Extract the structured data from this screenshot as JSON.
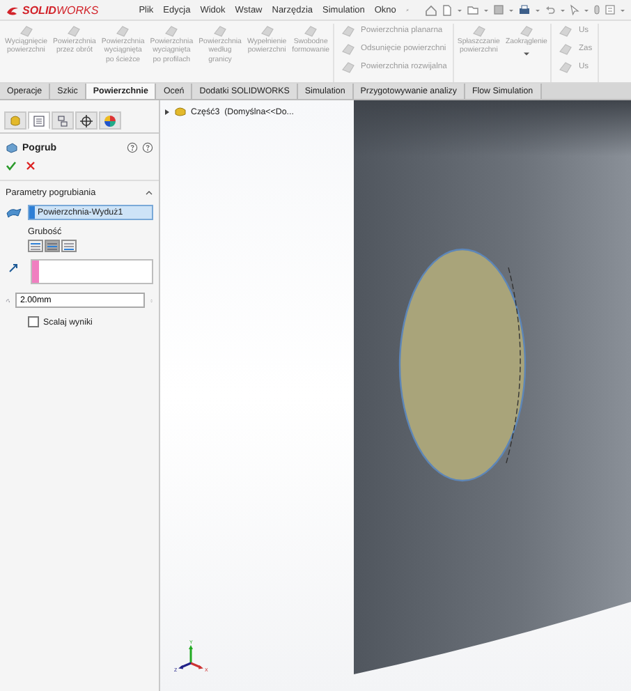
{
  "app": {
    "logo": "**SOLID**WORKS"
  },
  "menu": [
    "Plik",
    "Edycja",
    "Widok",
    "Wstaw",
    "Narzędzia",
    "Simulation",
    "Okno"
  ],
  "ribbon": [
    {
      "kind": "big",
      "lines": [
        "Wyciągnięcie",
        "powierzchni"
      ],
      "disabled": true
    },
    {
      "kind": "big",
      "lines": [
        "Powierzchnia",
        "przez obrót"
      ],
      "disabled": true
    },
    {
      "kind": "big",
      "lines": [
        "Powierzchnia",
        "wyciągnięta",
        "po ścieżce"
      ],
      "disabled": true
    },
    {
      "kind": "big",
      "lines": [
        "Powierzchnia",
        "wyciągnięta",
        "po profilach"
      ],
      "disabled": true
    },
    {
      "kind": "big",
      "lines": [
        "Powierzchnia",
        "według",
        "granicy"
      ],
      "disabled": true
    },
    {
      "kind": "big",
      "lines": [
        "Wypełnienie",
        "powierzchni"
      ],
      "disabled": true
    },
    {
      "kind": "big",
      "lines": [
        "Swobodne",
        "formowanie"
      ],
      "disabled": true
    },
    {
      "kind": "stack",
      "items": [
        {
          "label": "Powierzchnia planarna",
          "disabled": true
        },
        {
          "label": "Odsunięcie powierzchni",
          "disabled": true
        },
        {
          "label": "Powierzchnia rozwijalna",
          "disabled": true
        }
      ]
    },
    {
      "kind": "big",
      "lines": [
        "Spłaszczanie",
        "powierzchni"
      ],
      "disabled": true
    },
    {
      "kind": "big",
      "lines": [
        "Zaokrąglenie"
      ],
      "disabled": true,
      "dropdown": true
    },
    {
      "kind": "stack",
      "items": [
        {
          "label": "Us",
          "disabled": true
        },
        {
          "label": "Zas",
          "disabled": true
        },
        {
          "label": "Us",
          "disabled": true
        }
      ]
    }
  ],
  "tabs": [
    {
      "label": "Operacje",
      "selected": false
    },
    {
      "label": "Szkic",
      "selected": false
    },
    {
      "label": "Powierzchnie",
      "selected": true
    },
    {
      "label": "Oceń",
      "selected": false
    },
    {
      "label": "Dodatki SOLIDWORKS",
      "selected": false
    },
    {
      "label": "Simulation",
      "selected": false
    },
    {
      "label": "Przygotowywanie analizy",
      "selected": false
    },
    {
      "label": "Flow Simulation",
      "selected": false
    }
  ],
  "panel": {
    "tabs": [
      {
        "kind": "features",
        "selected": false
      },
      {
        "kind": "properties",
        "selected": true
      },
      {
        "kind": "configurations",
        "selected": false
      },
      {
        "kind": "dimxpert",
        "selected": false
      },
      {
        "kind": "appearance",
        "selected": false
      }
    ],
    "title": "Pogrub",
    "section": {
      "title": "Parametry pogrubiania",
      "expanded": true
    },
    "face_field": {
      "value": "Powierzchnia-Wyduż1"
    },
    "thickness_label": "Grubość",
    "thickness_sides": [
      {
        "kind": "side1",
        "selected": false
      },
      {
        "kind": "both",
        "selected": true
      },
      {
        "kind": "side2",
        "selected": false
      }
    ],
    "thickness": {
      "value": "2.00mm"
    },
    "merge": {
      "label": "Scalaj wyniki",
      "checked": false
    }
  },
  "tree": {
    "label": "Część3  (Domyślna<<Do..."
  },
  "triad": {
    "y": "Y",
    "x": "X",
    "z": "Z"
  }
}
